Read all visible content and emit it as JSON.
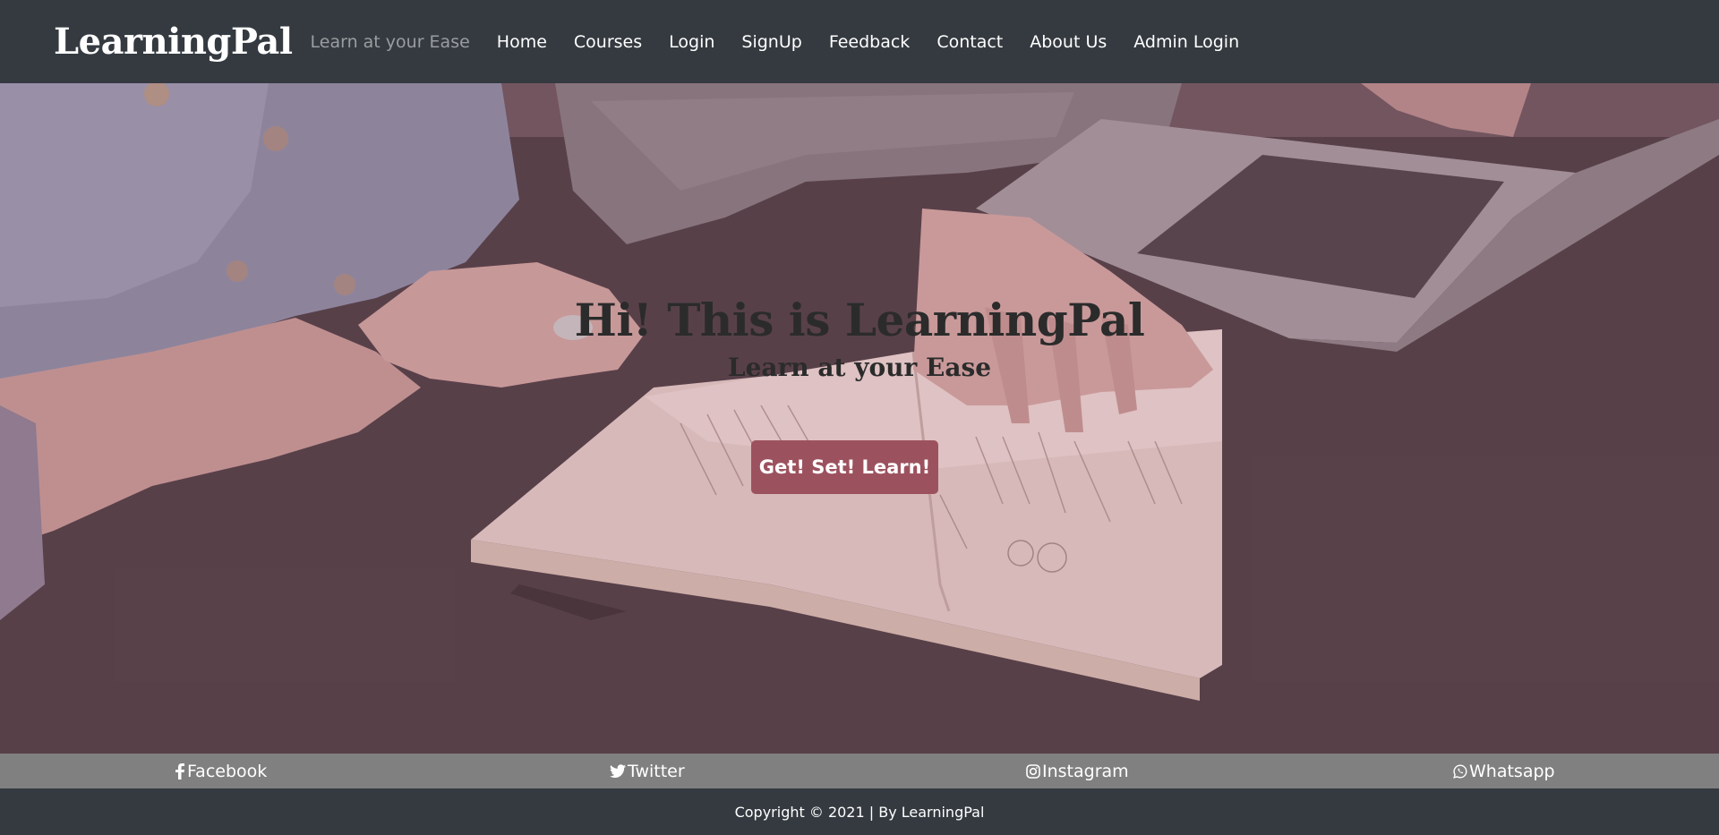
{
  "navbar": {
    "brand": "LearningPal",
    "tagline": "Learn at your Ease",
    "links": [
      {
        "label": "Home"
      },
      {
        "label": "Courses"
      },
      {
        "label": "Login"
      },
      {
        "label": "SignUp"
      },
      {
        "label": "Feedback"
      },
      {
        "label": "Contact"
      },
      {
        "label": "About Us"
      },
      {
        "label": "Admin Login"
      }
    ]
  },
  "hero": {
    "title": "Hi! This is LearningPal",
    "subtitle": "Learn at your Ease",
    "cta_label": "Get! Set! Learn!"
  },
  "social": {
    "links": [
      {
        "label": "Facebook",
        "icon": "facebook-icon"
      },
      {
        "label": "Twitter",
        "icon": "twitter-icon"
      },
      {
        "label": "Instagram",
        "icon": "instagram-icon"
      },
      {
        "label": "Whatsapp",
        "icon": "whatsapp-icon"
      }
    ]
  },
  "footer": {
    "copyright": "Copyright © 2021 | By LearningPal"
  },
  "colors": {
    "navbar_bg": "#343a40",
    "cta_bg": "#9c525e",
    "social_bar_bg": "#808080",
    "tagline": "#9a9da0"
  }
}
